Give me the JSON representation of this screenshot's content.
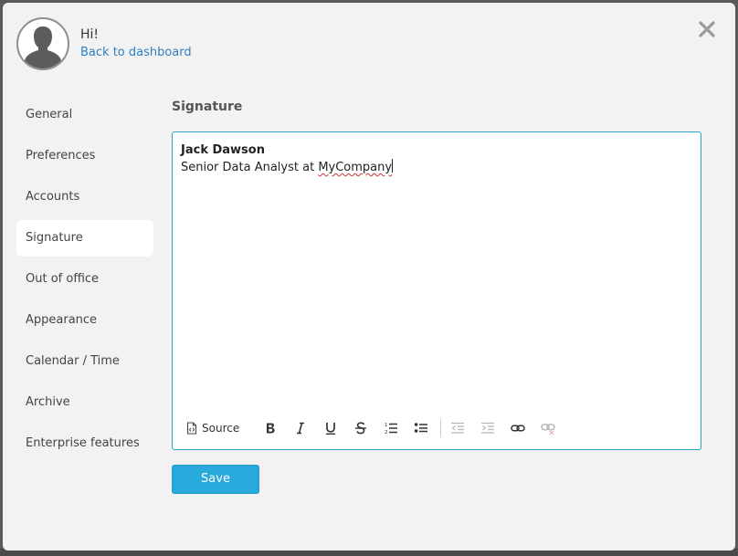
{
  "header": {
    "greeting": "Hi!",
    "back_link": "Back to dashboard"
  },
  "sidebar": {
    "items": [
      {
        "label": "General",
        "active": false
      },
      {
        "label": "Preferences",
        "active": false
      },
      {
        "label": "Accounts",
        "active": false
      },
      {
        "label": "Signature",
        "active": true
      },
      {
        "label": "Out of office",
        "active": false
      },
      {
        "label": "Appearance",
        "active": false
      },
      {
        "label": "Calendar / Time",
        "active": false
      },
      {
        "label": "Archive",
        "active": false
      },
      {
        "label": "Enterprise features",
        "active": false
      }
    ]
  },
  "main": {
    "section_title": "Signature",
    "editor": {
      "line1": "Jack Dawson",
      "line2_prefix": "Senior Data Analyst at ",
      "line2_misspelled": "MyCompany"
    },
    "toolbar": {
      "source_label": "Source",
      "icons": [
        "bold-icon",
        "italic-icon",
        "underline-icon",
        "strikethrough-icon",
        "numbered-list-icon",
        "bulleted-list-icon",
        "decrease-indent-icon",
        "increase-indent-icon",
        "link-icon",
        "unlink-icon"
      ]
    },
    "save_label": "Save"
  },
  "colors": {
    "accent": "#29a8dc",
    "link": "#2f7fc1",
    "editor_border": "#29a3c8",
    "modal_bg": "#f2f2f2"
  }
}
